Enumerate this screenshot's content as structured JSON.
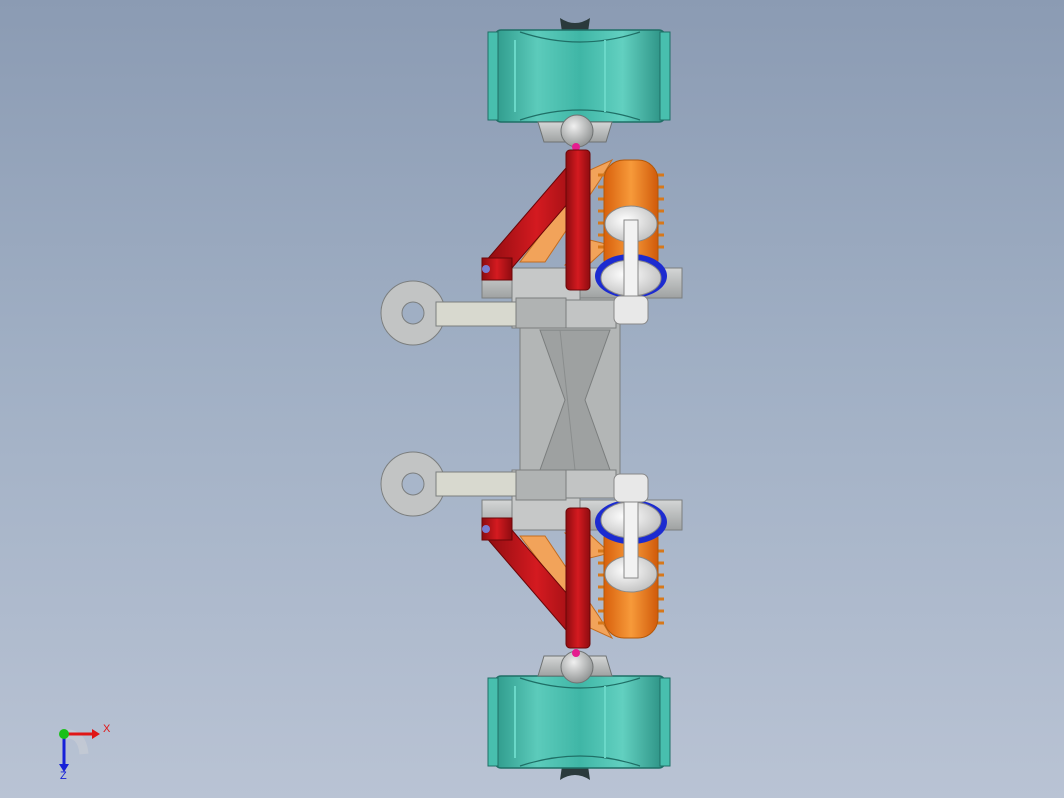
{
  "view": {
    "background_top": "#8b9bb3",
    "background_bottom": "#b9c3d4"
  },
  "colors": {
    "wheel": "#3fb6a6",
    "control_arm": "#c0141a",
    "shock_body": "#f07c1a",
    "spring": "#f29d3a",
    "bushing": "#1c2bd0",
    "frame": "#b9bcbc",
    "knuckle": "#c4c6c6",
    "ball_joint": "#e51c8f"
  },
  "triad": {
    "x_label": "X",
    "z_label": "Z",
    "x_color": "#e01616",
    "y_color": "#18c018",
    "z_color": "#1620d8"
  }
}
